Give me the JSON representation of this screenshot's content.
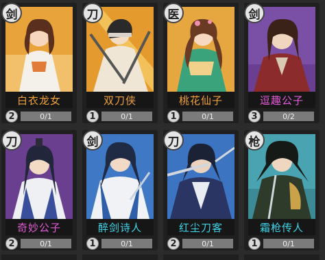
{
  "cards": [
    {
      "badge": "剑",
      "name": "白衣龙女",
      "level": "2",
      "progress": "0/1"
    },
    {
      "badge": "刀",
      "name": "双刀侠",
      "level": "1",
      "progress": "0/1"
    },
    {
      "badge": "医",
      "name": "桃花仙子",
      "level": "1",
      "progress": "0/1"
    },
    {
      "badge": "剑",
      "name": "逗趣公子",
      "level": "3",
      "progress": "0/2"
    },
    {
      "badge": "刀",
      "name": "奇妙公子",
      "level": "2",
      "progress": "0/1"
    },
    {
      "badge": "剑",
      "name": "醉剑诗人",
      "level": "1",
      "progress": "0/1"
    },
    {
      "badge": "刀",
      "name": "红尘刀客",
      "level": "2",
      "progress": "0/1"
    },
    {
      "badge": "枪",
      "name": "霜枪传人",
      "level": "1",
      "progress": "0/1"
    }
  ],
  "colors": {
    "name_orange": "#f0a23a",
    "name_pink": "#e35bd6",
    "name_cyan": "#3fd6ea"
  }
}
